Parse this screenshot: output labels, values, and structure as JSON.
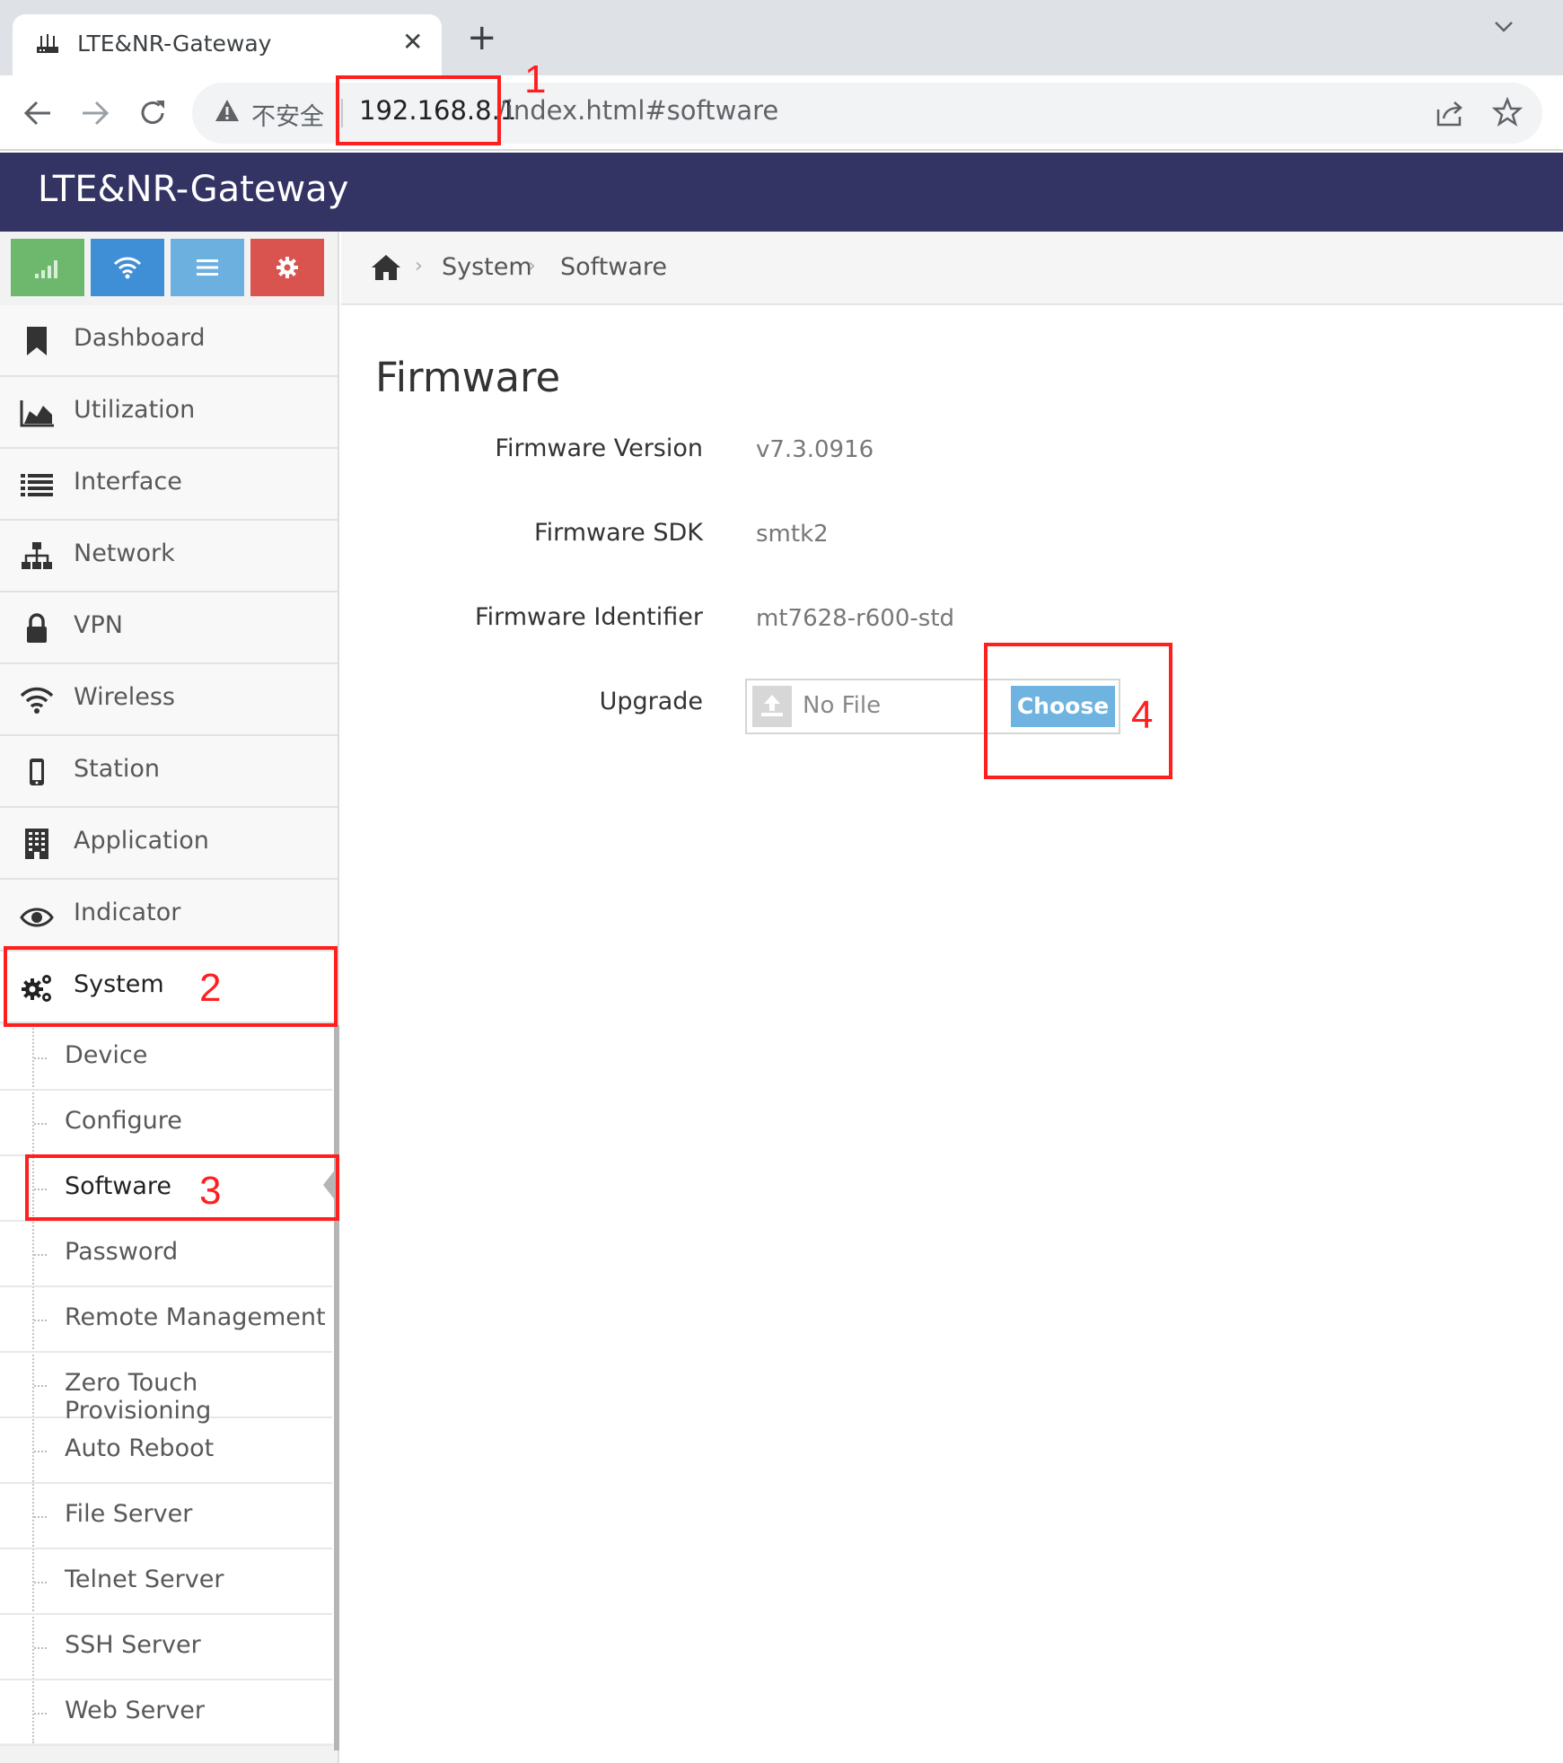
{
  "browser": {
    "tab_title": "LTE&NR-Gateway",
    "close_glyph": "✕",
    "new_tab_glyph": "+",
    "not_secure": "不安全",
    "url_host": "192.168.8.1",
    "url_path": "/index.html#software"
  },
  "app": {
    "title": "LTE&NR-Gateway"
  },
  "shortcuts": [
    {
      "icon": "signal-icon",
      "color": "#6db86d"
    },
    {
      "icon": "wifi-icon",
      "color": "#3f8fd6"
    },
    {
      "icon": "list-icon",
      "color": "#6cb0e0"
    },
    {
      "icon": "gear-icon",
      "color": "#d9534f"
    }
  ],
  "nav": {
    "items": [
      {
        "label": "Dashboard",
        "icon": "bookmark-icon"
      },
      {
        "label": "Utilization",
        "icon": "area-chart-icon"
      },
      {
        "label": "Interface",
        "icon": "list-icon"
      },
      {
        "label": "Network",
        "icon": "sitemap-icon"
      },
      {
        "label": "VPN",
        "icon": "lock-icon"
      },
      {
        "label": "Wireless",
        "icon": "wifi-icon"
      },
      {
        "label": "Station",
        "icon": "mobile-icon"
      },
      {
        "label": "Application",
        "icon": "building-icon"
      },
      {
        "label": "Indicator",
        "icon": "eye-icon"
      },
      {
        "label": "System",
        "icon": "cogs-icon"
      }
    ],
    "sub_items": [
      "Device",
      "Configure",
      "Software",
      "Password",
      "Remote Management",
      "Zero Touch Provisioning",
      "Auto Reboot",
      "File Server",
      "Telnet Server",
      "SSH Server",
      "Web Server"
    ],
    "active_item": "System",
    "active_sub": "Software"
  },
  "breadcrumb": {
    "items": [
      "System",
      "Software"
    ]
  },
  "main": {
    "heading": "Firmware",
    "rows": [
      {
        "label": "Firmware Version",
        "value": "v7.3.0916"
      },
      {
        "label": "Firmware SDK",
        "value": "smtk2"
      },
      {
        "label": "Firmware Identifier",
        "value": "mt7628-r600-std"
      }
    ],
    "upgrade_label": "Upgrade",
    "file_placeholder": "No File",
    "choose_label": "Choose"
  },
  "annotations": [
    "1",
    "2",
    "3",
    "4"
  ]
}
